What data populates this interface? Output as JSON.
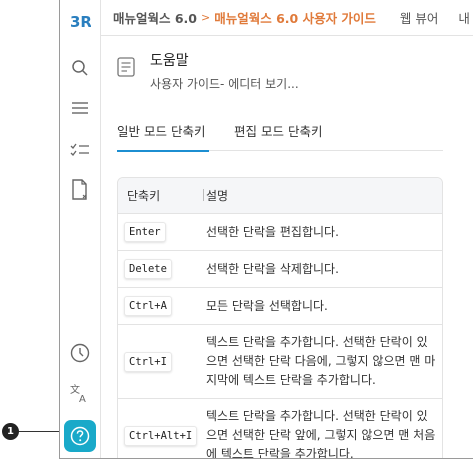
{
  "callout": {
    "number": "1"
  },
  "breadcrumb": {
    "product": "매뉴얼웍스 6.0",
    "separator": ">",
    "current": "매뉴얼웍스 6.0 사용자 가이드",
    "item3": "웹 뷰어",
    "item4": "내"
  },
  "doc": {
    "title": "도움말",
    "subtitle": "사용자 가이드- 에디터 보기..."
  },
  "tabs": [
    {
      "label": "일반 모드 단축키",
      "active": true
    },
    {
      "label": "편집 모드 단축키",
      "active": false
    }
  ],
  "table": {
    "headers": {
      "key": "단축키",
      "desc": "설명"
    },
    "rows": [
      {
        "key": "Enter",
        "desc": "선택한 단락을 편집합니다."
      },
      {
        "key": "Delete",
        "desc": "선택한 단락을 삭제합니다."
      },
      {
        "key": "Ctrl+A",
        "desc": "모든 단락을 선택합니다."
      },
      {
        "key": "Ctrl+I",
        "desc": "텍스트 단락을 추가합니다. 선택한 단락이 있으면 선택한 단락 다음에, 그렇지 않으면 맨 마지막에 텍스트 단락을 추가합니다."
      },
      {
        "key": "Ctrl+Alt+I",
        "desc": "텍스트 단락을 추가합니다. 선택한 단락이 있으면 선택한 단락 앞에, 그렇지 않으면 맨 처음에 텍스트 단락을 추가합니다."
      }
    ]
  },
  "sidebar": {
    "icons": [
      "logo-icon",
      "search-icon",
      "menu-icon",
      "checklist-icon",
      "document-icon",
      "history-icon",
      "translate-icon",
      "help-icon"
    ]
  },
  "colors": {
    "accent": "#19a9c9",
    "breadcrumb_active": "#e07a3a",
    "tab_underline": "#1c8ed1"
  }
}
